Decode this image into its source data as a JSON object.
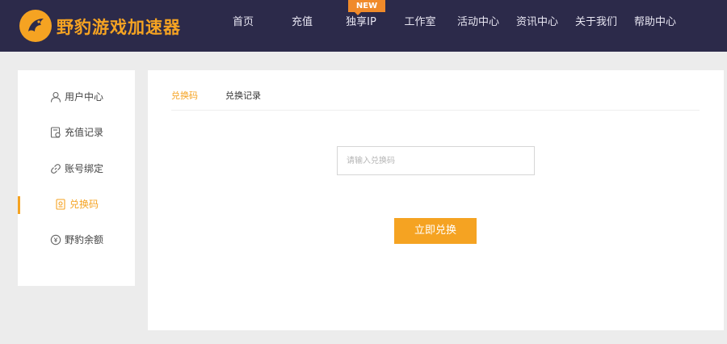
{
  "header": {
    "logo_text": "野豹游戏加速器",
    "nav": [
      {
        "label": "首页"
      },
      {
        "label": "充值"
      },
      {
        "label": "独享IP",
        "badge": "NEW"
      },
      {
        "label": "工作室"
      },
      {
        "label": "活动中心"
      },
      {
        "label": "资讯中心"
      },
      {
        "label": "关于我们"
      },
      {
        "label": "帮助中心"
      }
    ]
  },
  "sidebar": {
    "items": [
      {
        "label": "用户中心",
        "icon": "user-icon"
      },
      {
        "label": "充值记录",
        "icon": "recharge-record-icon"
      },
      {
        "label": "账号绑定",
        "icon": "link-icon"
      },
      {
        "label": "兑换码",
        "icon": "redeem-code-icon",
        "active": true
      },
      {
        "label": "野豹余额",
        "icon": "balance-icon"
      }
    ]
  },
  "main": {
    "tabs": [
      {
        "label": "兑换码",
        "active": true
      },
      {
        "label": "兑换记录",
        "active": false
      }
    ],
    "input": {
      "value": "",
      "placeholder": "请输入兑换码"
    },
    "submit_label": "立即兑换"
  },
  "colors": {
    "header_bg": "#2c2a4a",
    "accent": "#f5a322",
    "badge": "#f08a2a"
  }
}
